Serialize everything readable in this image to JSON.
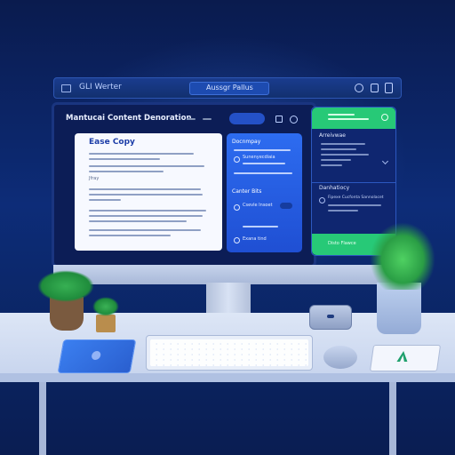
{
  "topbar": {
    "menu_text": "GLI Werter",
    "search_text": "Aussgr Pallus"
  },
  "editor": {
    "title": "Mantucai Content Denoration",
    "doc_title": "Ease Copy",
    "subtitle": "Jfray",
    "rows": [
      "",
      "",
      "",
      "",
      "",
      "",
      ""
    ]
  },
  "side_panel": {
    "heading_1": "Docnmpay",
    "heading_2": "Canter Bits",
    "item_1": "Sunenyecdiaia",
    "item_2": "Csevle Insoet",
    "item_3": "Exana tind"
  },
  "right_panel": {
    "card_1_title": "Arreivwae",
    "card_2_title": "Danhatiocy",
    "card_2_item": "Fipexe Cucfonta Sannolacet",
    "footer_button": "Disto Flawce"
  },
  "colors": {
    "accent_blue": "#2a63e8",
    "accent_green": "#1fc36e"
  }
}
